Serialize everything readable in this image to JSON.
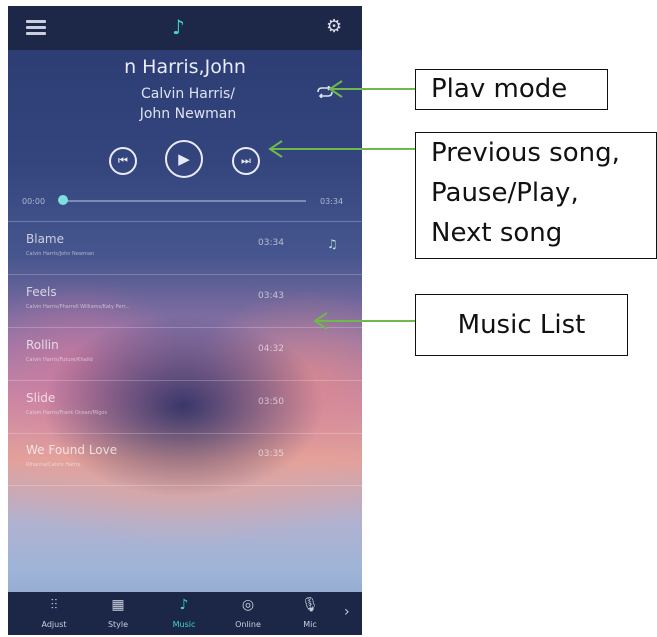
{
  "header": {
    "menu_icon": "menu-icon",
    "logo_icon": "music-note-icon",
    "settings_icon": "gear-icon"
  },
  "now_playing": {
    "title": "n Harris,John",
    "artist": "Calvin Harris/\nJohn Newman",
    "time_elapsed": "00:00",
    "time_total": "03:34",
    "progress": 0.0
  },
  "controls": {
    "prev_icon": "⏮",
    "play_icon": "▶",
    "next_icon": "⏭"
  },
  "songs": [
    {
      "title": "Blame",
      "artist": "Calvin Harris/John Newman",
      "duration": "03:34"
    },
    {
      "title": "Feels",
      "artist": "Calvin Harris/Pharrell Williams/Katy Perr...",
      "duration": "03:43"
    },
    {
      "title": "Rollin",
      "artist": "Calvin Harris/Future/Khalid",
      "duration": "04:32"
    },
    {
      "title": "Slide",
      "artist": "Calvin Harris/Frank Ocean/Migos",
      "duration": "03:50"
    },
    {
      "title": "We Found Love",
      "artist": "Rihanna/Calvin Harris",
      "duration": "03:35"
    }
  ],
  "tabs": [
    {
      "label": "Adjust",
      "icon": "sliders-icon"
    },
    {
      "label": "Style",
      "icon": "grid-icon"
    },
    {
      "label": "Music",
      "icon": "music-note-icon"
    },
    {
      "label": "Online",
      "icon": "globe-icon"
    },
    {
      "label": "Mic",
      "icon": "microphone-icon"
    }
  ],
  "annotations": {
    "play_mode": "Plav mode",
    "controls": "Previous song,\nPause/Play,\nNext song",
    "music_list": "Music List"
  },
  "colors": {
    "accent": "#3fd6c8",
    "bar": "#1d2848",
    "arrow": "#6fb84a"
  }
}
